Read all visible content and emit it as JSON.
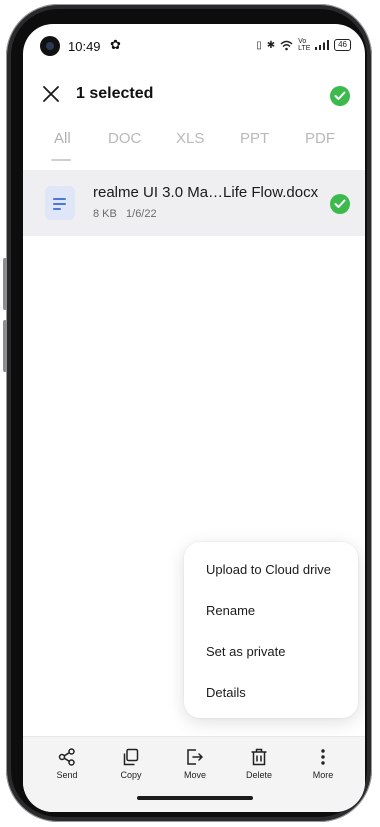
{
  "status_bar": {
    "time": "10:49",
    "gear_icon": "gear-icon",
    "network_label": "Vo LTE",
    "battery": "46"
  },
  "header": {
    "title": "1 selected",
    "close_icon": "close-icon",
    "select_all_icon": "check-circle-icon"
  },
  "tabs": [
    {
      "label": "All",
      "active": true
    },
    {
      "label": "DOC",
      "active": false
    },
    {
      "label": "XLS",
      "active": false
    },
    {
      "label": "PPT",
      "active": false
    },
    {
      "label": "PDF",
      "active": false
    }
  ],
  "file": {
    "name": "realme UI 3.0 Ma…Life Flow.docx",
    "meta": "8 KB   1/6/22",
    "selected": true
  },
  "menu": {
    "items": [
      {
        "label": "Upload to Cloud drive"
      },
      {
        "label": "Rename"
      },
      {
        "label": "Set as private"
      },
      {
        "label": "Details"
      }
    ]
  },
  "actions": [
    {
      "label": "Send",
      "icon": "share-icon"
    },
    {
      "label": "Copy",
      "icon": "copy-icon"
    },
    {
      "label": "Move",
      "icon": "move-icon"
    },
    {
      "label": "Delete",
      "icon": "trash-icon"
    },
    {
      "label": "More",
      "icon": "more-vertical-icon"
    }
  ],
  "colors": {
    "accent_green": "#3dba4e",
    "doc_blue": "#4f76d9",
    "selected_row_bg": "#efeff1"
  }
}
